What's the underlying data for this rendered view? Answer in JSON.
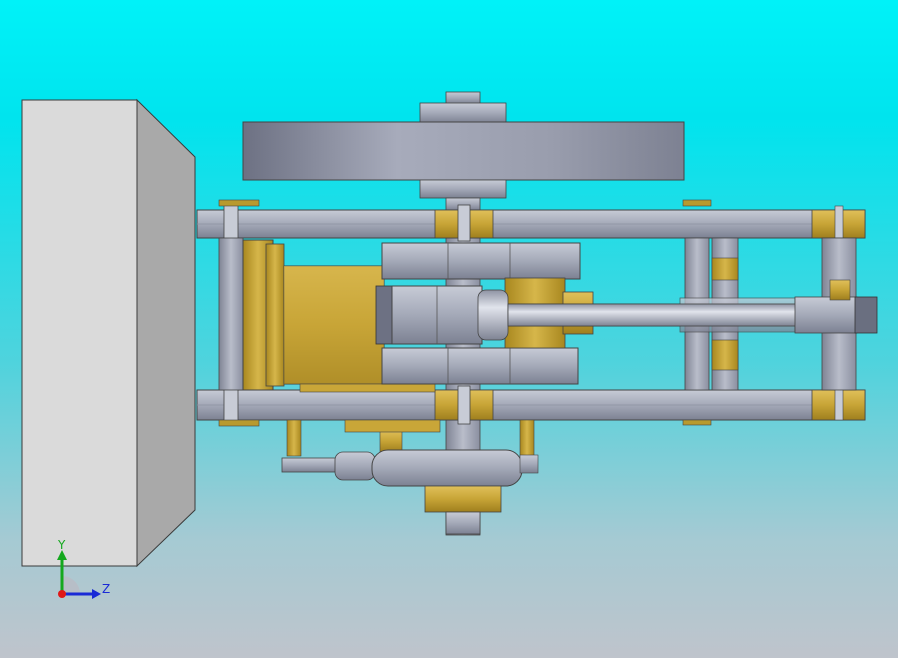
{
  "viewport": {
    "kind": "cad-3d-view",
    "background_top": "#00f2f8",
    "background_bottom": "#bfc4cc"
  },
  "model": {
    "parts": [
      "base-block",
      "flywheel",
      "frame-rails",
      "cylinder",
      "piston-rod",
      "crosshead",
      "eccentric"
    ],
    "colors": {
      "steel": "#9aa0b0",
      "brass": "#c9a638",
      "base": "#d9d9d9"
    }
  },
  "triad": {
    "y_label": "Y",
    "z_label": "Z",
    "y_color": "#14a81e",
    "z_color": "#1a2ad6",
    "origin_color": "#e01818"
  }
}
